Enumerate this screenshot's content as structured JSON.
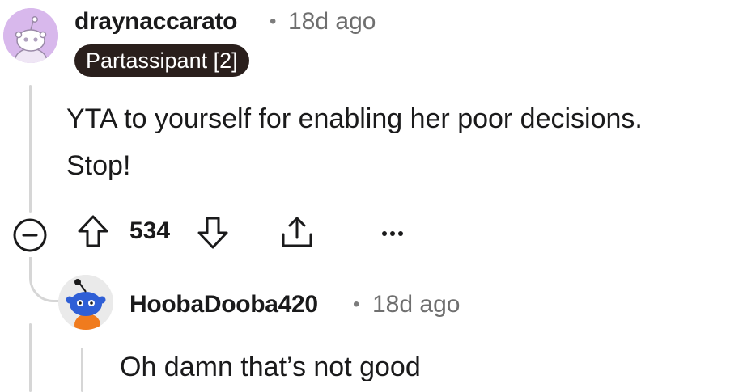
{
  "comment": {
    "username": "draynaccarato",
    "separator": "•",
    "time": "18d ago",
    "flair": "Partassipant [2]",
    "body_lines": [
      "YTA to yourself for enabling her poor decisions.",
      "Stop!"
    ],
    "votes": "534",
    "avatar_color": "#d8b8ec",
    "icons": [
      "collapse-icon",
      "upvote-icon",
      "downvote-icon",
      "share-icon",
      "more-options-icon"
    ]
  },
  "reply": {
    "username": "HoobaDooba420",
    "separator": "•",
    "time": "18d ago",
    "body": "Oh damn that’s not good",
    "avatar_color": "#2f5fd6"
  }
}
